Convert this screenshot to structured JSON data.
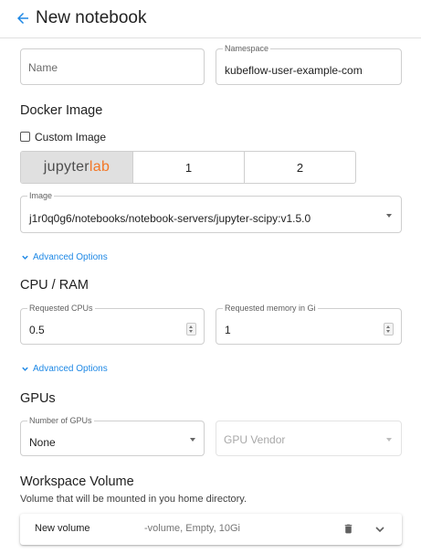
{
  "header": {
    "title": "New notebook",
    "back_icon": "arrow-left-icon"
  },
  "name_field": {
    "placeholder": "Name",
    "value": ""
  },
  "namespace_field": {
    "label": "Namespace",
    "value": "kubeflow-user-example-com"
  },
  "docker_image": {
    "title": "Docker Image",
    "custom_image_label": "Custom Image",
    "custom_image_checked": false,
    "options": [
      {
        "logo_primary": "jupyter",
        "logo_accent": "lab",
        "selected": true
      },
      {
        "label": "1",
        "selected": false
      },
      {
        "label": "2",
        "selected": false
      }
    ],
    "image_label": "Image",
    "image_value": "j1r0q0g6/notebooks/notebook-servers/jupyter-scipy:v1.5.0",
    "advanced_options": "Advanced Options"
  },
  "cpu_ram": {
    "title": "CPU / RAM",
    "cpu_label": "Requested CPUs",
    "cpu_value": "0.5",
    "memory_label": "Requested memory in Gi",
    "memory_value": "1",
    "advanced_options": "Advanced Options"
  },
  "gpus": {
    "title": "GPUs",
    "count_label": "Number of GPUs",
    "count_value": "None",
    "vendor_placeholder": "GPU Vendor"
  },
  "workspace_volume": {
    "title": "Workspace Volume",
    "subtitle": "Volume that will be mounted in you home directory.",
    "volume_name": "New volume",
    "volume_desc": "-volume, Empty, 10Gi"
  },
  "colors": {
    "accent": "#1e88e5",
    "jupyter_orange": "#f37726",
    "selected_toggle": "#e0e0e0"
  }
}
